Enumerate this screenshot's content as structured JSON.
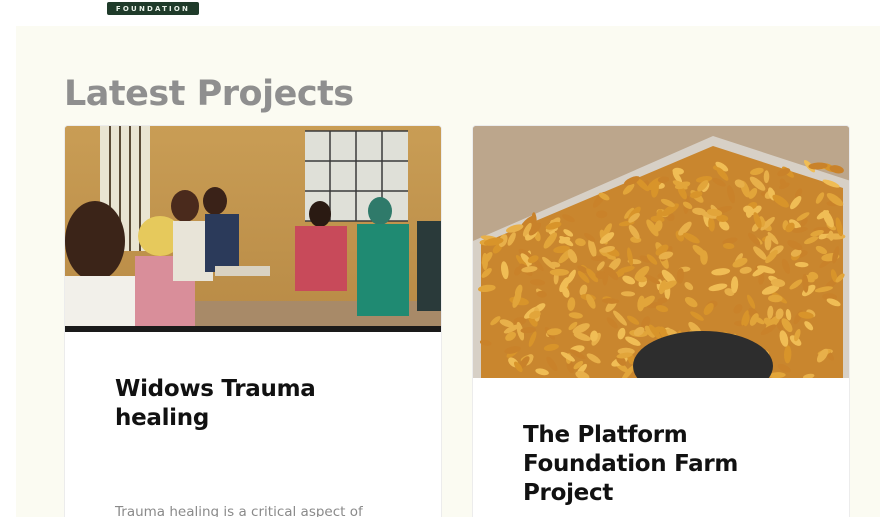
{
  "header": {
    "logo_text": "FOUNDATION"
  },
  "section": {
    "title": "Latest Projects"
  },
  "cards": [
    {
      "title": "Widows Trauma healing",
      "excerpt": "Trauma healing is a critical aspect of",
      "image": "women-group-meeting-photo"
    },
    {
      "title": "The Platform Foundation Farm Project",
      "image": "harvested-maize-photo"
    }
  ],
  "colors": {
    "section_bg": "#fbfbf2",
    "title_gray": "#8f8f8f",
    "logo_green": "#1f3b2a"
  }
}
